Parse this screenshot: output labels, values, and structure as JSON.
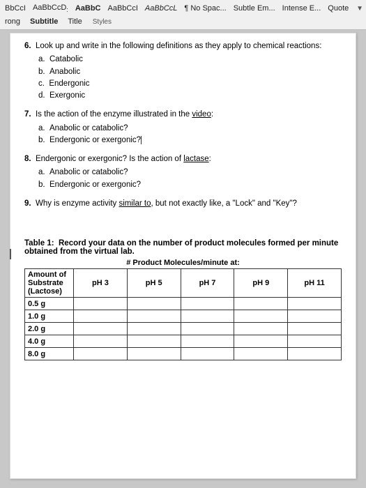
{
  "toolbar": {
    "styles_label": "Styles",
    "style_items": [
      {
        "id": "bbcci",
        "label": "BbCcI",
        "type": "normal"
      },
      {
        "id": "aabbccd",
        "label": "AaBbCcD:",
        "type": "normal"
      },
      {
        "id": "aabbc",
        "label": "AaBbC",
        "type": "bold"
      },
      {
        "id": "aabbcci",
        "label": "AaBbCcI",
        "type": "normal"
      },
      {
        "id": "aabbccl",
        "label": "AaBbCcL",
        "type": "italic"
      },
      {
        "id": "nospace",
        "label": "¶ No Spac...",
        "type": "normal"
      },
      {
        "id": "subtleem",
        "label": "Subtle Em...",
        "type": "normal"
      },
      {
        "id": "intensee",
        "label": "Intense E...",
        "type": "normal"
      },
      {
        "id": "quote",
        "label": "Quote",
        "type": "normal"
      }
    ],
    "nav_items": [
      {
        "id": "rong",
        "label": "rong"
      },
      {
        "id": "subtitle",
        "label": "Subtitle"
      },
      {
        "id": "title",
        "label": "Title"
      }
    ]
  },
  "document": {
    "questions": [
      {
        "number": "6.",
        "text": "Look up and write in the following definitions as they apply to chemical reactions:",
        "items": [
          {
            "letter": "a.",
            "text": "Catabolic"
          },
          {
            "letter": "b.",
            "text": "Anabolic"
          },
          {
            "letter": "c.",
            "text": "Endergonic"
          },
          {
            "letter": "d.",
            "text": "Exergonic"
          }
        ]
      },
      {
        "number": "7.",
        "text": "Is the action of the enzyme illustrated in the video:",
        "video_underlined": "video",
        "items": [
          {
            "letter": "a.",
            "text": "Anabolic or catabolic?"
          },
          {
            "letter": "b.",
            "text": "Endergonic or exergonic?"
          }
        ]
      },
      {
        "number": "8.",
        "text": "Endergonic or exergonic? Is the action of lactase:",
        "lactase_underlined": "lactase",
        "items": [
          {
            "letter": "a.",
            "text": "Anabolic or catabolic?"
          },
          {
            "letter": "b.",
            "text": "Endergonic or exergonic?"
          }
        ]
      },
      {
        "number": "9.",
        "text": "Why is enzyme activity similar to, but not exactly like, a \"Lock\" and \"Key\"?",
        "similar_underlined": "similar to"
      }
    ],
    "table": {
      "title": "Table 1:  Record your data on the number of product molecules formed per minute obtained from the virtual lab.",
      "subtitle": "# Product Molecules/minute at:",
      "col_header": "Amount of Substrate (Lactose)",
      "columns": [
        "pH 3",
        "pH 5",
        "pH 7",
        "pH 9",
        "pH 11"
      ],
      "rows": [
        {
          "substrate": "0.5 g",
          "values": [
            "",
            "",
            "",
            "",
            ""
          ]
        },
        {
          "substrate": "1.0 g",
          "values": [
            "",
            "",
            "",
            "",
            ""
          ]
        },
        {
          "substrate": "2.0 g",
          "values": [
            "",
            "",
            "",
            "",
            ""
          ]
        },
        {
          "substrate": "4.0 g",
          "values": [
            "",
            "",
            "",
            "",
            ""
          ]
        },
        {
          "substrate": "8.0 g",
          "values": [
            "",
            "",
            "",
            "",
            ""
          ]
        }
      ]
    }
  }
}
